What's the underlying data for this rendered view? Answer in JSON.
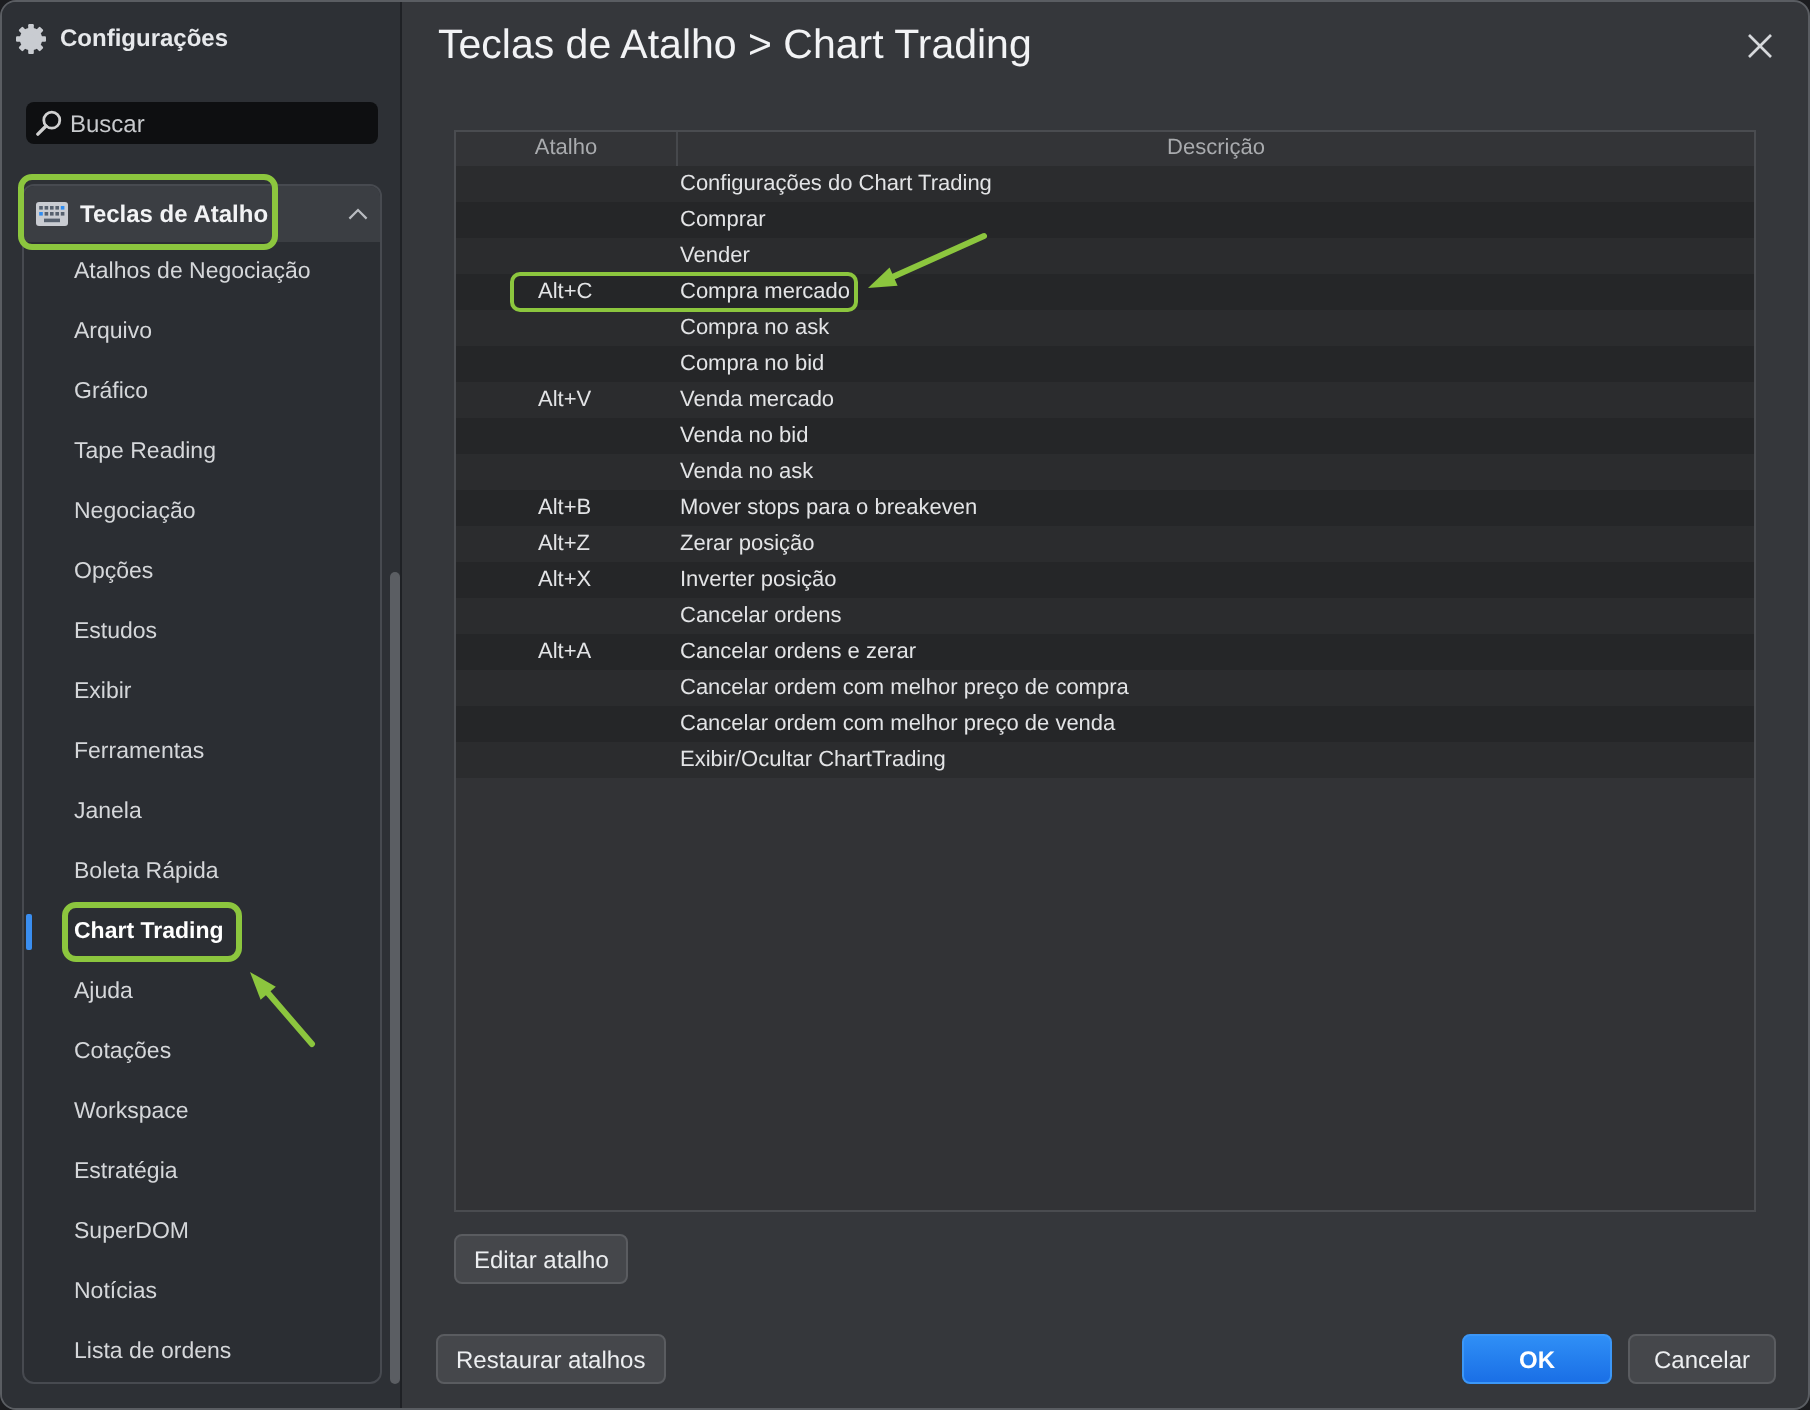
{
  "sidebar": {
    "title": "Configurações",
    "search": {
      "placeholder": "Buscar"
    },
    "group": {
      "label": "Teclas de Atalho",
      "expanded": true,
      "highlighted": true,
      "items": [
        {
          "label": "Atalhos de Negociação",
          "selected": false,
          "highlighted": false
        },
        {
          "label": "Arquivo",
          "selected": false,
          "highlighted": false
        },
        {
          "label": "Gráfico",
          "selected": false,
          "highlighted": false
        },
        {
          "label": "Tape Reading",
          "selected": false,
          "highlighted": false
        },
        {
          "label": "Negociação",
          "selected": false,
          "highlighted": false
        },
        {
          "label": "Opções",
          "selected": false,
          "highlighted": false
        },
        {
          "label": "Estudos",
          "selected": false,
          "highlighted": false
        },
        {
          "label": "Exibir",
          "selected": false,
          "highlighted": false
        },
        {
          "label": "Ferramentas",
          "selected": false,
          "highlighted": false
        },
        {
          "label": "Janela",
          "selected": false,
          "highlighted": false
        },
        {
          "label": "Boleta Rápida",
          "selected": false,
          "highlighted": false
        },
        {
          "label": "Chart Trading",
          "selected": true,
          "highlighted": true,
          "arrow": true
        },
        {
          "label": "Ajuda",
          "selected": false,
          "highlighted": false
        },
        {
          "label": "Cotações",
          "selected": false,
          "highlighted": false
        },
        {
          "label": "Workspace",
          "selected": false,
          "highlighted": false
        },
        {
          "label": "Estratégia",
          "selected": false,
          "highlighted": false
        },
        {
          "label": "SuperDOM",
          "selected": false,
          "highlighted": false
        },
        {
          "label": "Notícias",
          "selected": false,
          "highlighted": false
        },
        {
          "label": "Lista de ordens",
          "selected": false,
          "highlighted": false
        }
      ]
    }
  },
  "title": "Teclas de Atalho > Chart Trading",
  "table": {
    "columns": [
      "Atalho",
      "Descrição"
    ],
    "rows": [
      {
        "description": "Configurações do Chart Trading",
        "highlighted": false
      },
      {
        "description": "Comprar",
        "highlighted": false
      },
      {
        "description": "Vender",
        "highlighted": false
      },
      {
        "shortcut": "Alt+C",
        "description": "Compra mercado",
        "highlighted": true,
        "arrow": true
      },
      {
        "description": "Compra no ask",
        "highlighted": false
      },
      {
        "description": "Compra no bid",
        "highlighted": false
      },
      {
        "shortcut": "Alt+V",
        "description": "Venda mercado",
        "highlighted": false
      },
      {
        "description": "Venda no bid",
        "highlighted": false
      },
      {
        "description": "Venda no ask",
        "highlighted": false
      },
      {
        "shortcut": "Alt+B",
        "description": "Mover stops para o breakeven",
        "highlighted": false
      },
      {
        "shortcut": "Alt+Z",
        "description": "Zerar posição",
        "highlighted": false
      },
      {
        "shortcut": "Alt+X",
        "description": "Inverter posição",
        "highlighted": false
      },
      {
        "description": "Cancelar ordens",
        "highlighted": false
      },
      {
        "shortcut": "Alt+A",
        "description": "Cancelar ordens e zerar",
        "highlighted": false
      },
      {
        "description": "Cancelar ordem com melhor preço de compra",
        "highlighted": false
      },
      {
        "description": "Cancelar ordem com melhor preço de venda",
        "highlighted": false
      },
      {
        "description": "Exibir/Ocultar ChartTrading",
        "highlighted": false
      }
    ]
  },
  "edit_button": "Editar atalho",
  "footer": {
    "left_buttons": [
      {
        "label": "Restaurar atalhos",
        "kind": "default"
      }
    ],
    "right_buttons": [
      {
        "label": "OK",
        "kind": "primary"
      },
      {
        "label": "Cancelar",
        "kind": "default"
      }
    ]
  }
}
